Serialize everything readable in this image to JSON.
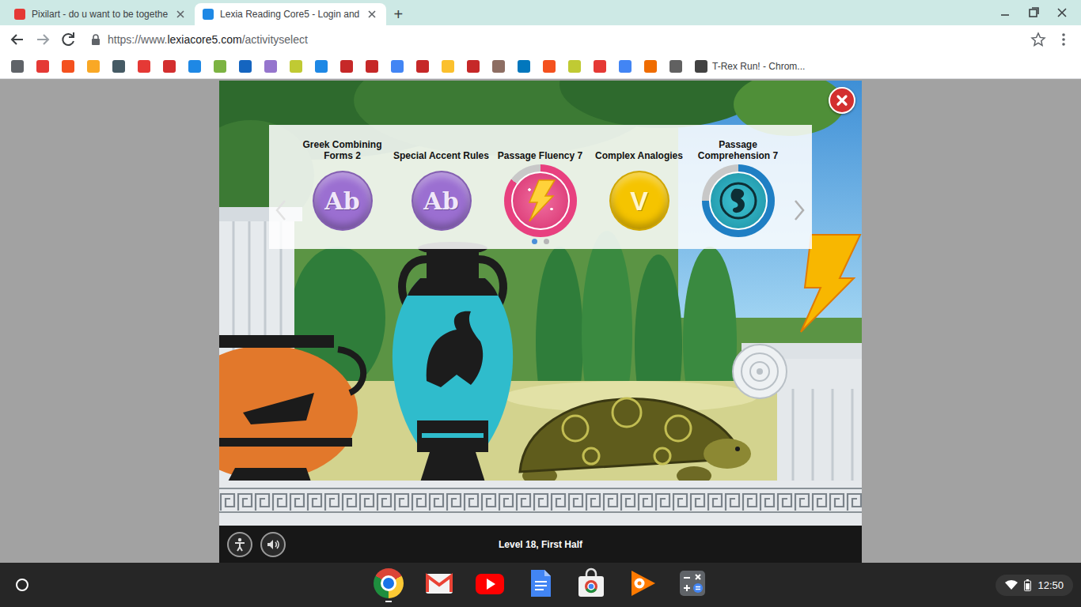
{
  "browser": {
    "tabs": [
      {
        "title": "Pixilart - do u want to be togethe",
        "selected": false,
        "color": "#e53935"
      },
      {
        "title": "Lexia Reading Core5 - Login and",
        "selected": true,
        "color": "#1e88e5"
      }
    ],
    "new_tab": "+",
    "address": {
      "scheme": "https://www.",
      "domain": "lexiacore5.com",
      "path": "/activityselect"
    },
    "bookmarks": [
      {
        "color": "#5f6368"
      },
      {
        "color": "#e53935"
      },
      {
        "color": "#f4511e"
      },
      {
        "color": "#f9a825"
      },
      {
        "color": "#455a64"
      },
      {
        "color": "#e53935"
      },
      {
        "color": "#d32f2f"
      },
      {
        "color": "#1e88e5"
      },
      {
        "color": "#7cb342"
      },
      {
        "color": "#1565c0"
      },
      {
        "color": "#9575cd"
      },
      {
        "color": "#c0ca33"
      },
      {
        "color": "#1e88e5"
      },
      {
        "color": "#c62828"
      },
      {
        "color": "#c62828"
      },
      {
        "color": "#4285f4"
      },
      {
        "color": "#c62828"
      },
      {
        "color": "#fbc02d"
      },
      {
        "color": "#c62828"
      },
      {
        "color": "#8d6e63"
      },
      {
        "color": "#0277bd"
      },
      {
        "color": "#f4511e"
      },
      {
        "color": "#c0ca33"
      },
      {
        "color": "#e53935"
      },
      {
        "color": "#4285f4"
      },
      {
        "color": "#ef6c00"
      },
      {
        "color": "#616161"
      },
      {
        "color": "#424242",
        "label": "T-Rex Run! - Chrom..."
      }
    ]
  },
  "game": {
    "activities": [
      {
        "name": "Greek Combining Forms 2",
        "kind": "word",
        "color": "#9b6fd1",
        "badge": "Ab"
      },
      {
        "name": "Special Accent Rules",
        "kind": "word",
        "color": "#9b6fd1",
        "badge": "Ab"
      },
      {
        "name": "Passage Fluency 7",
        "kind": "fluency",
        "color": "#e8407f",
        "level": 0.85
      },
      {
        "name": "Complex Analogies",
        "kind": "vocabulary",
        "color": "#f5c400",
        "badge": "V"
      },
      {
        "name": "Passage Comprehension 7",
        "kind": "comprehension",
        "color": "#1f7fc4",
        "level": 0.75
      }
    ],
    "pager": {
      "prev_enabled": false,
      "next_enabled": true,
      "pages": [
        {
          "selected": true
        },
        {
          "selected": false
        }
      ]
    },
    "level_label": "Level 18, First Half"
  },
  "taskbar": {
    "apps": [
      {
        "kind": "chrome",
        "running": true
      },
      {
        "kind": "gmail",
        "running": false
      },
      {
        "kind": "youtube",
        "running": false
      },
      {
        "kind": "docs",
        "running": false
      },
      {
        "kind": "webstore",
        "running": false
      },
      {
        "kind": "playmusic",
        "running": false
      },
      {
        "kind": "calculator",
        "running": false
      }
    ],
    "time": "12:50"
  }
}
